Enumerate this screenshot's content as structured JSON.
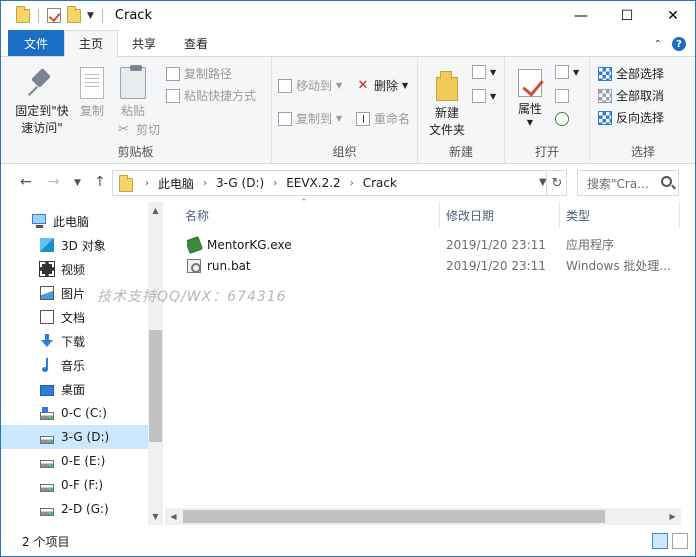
{
  "window": {
    "title": "Crack",
    "minimize": "—",
    "maximize": "☐",
    "close": "✕"
  },
  "tabs": [
    {
      "label": "文件"
    },
    {
      "label": "主页"
    },
    {
      "label": "共享"
    },
    {
      "label": "查看"
    }
  ],
  "ribbon": {
    "clipboard": {
      "label": "剪贴板",
      "pin": "固定到\"快\n速访问\"",
      "copy": "复制",
      "paste": "粘贴",
      "copy_path": "复制路径",
      "paste_shortcut": "粘贴快捷方式",
      "cut": "剪切"
    },
    "organize": {
      "label": "组织",
      "move_to": "移动到",
      "copy_to": "复制到",
      "delete": "删除",
      "rename": "重命名"
    },
    "new": {
      "label": "新建",
      "new_folder": "新建\n文件夹"
    },
    "open": {
      "label": "打开",
      "properties": "属性"
    },
    "select": {
      "label": "选择",
      "select_all": "全部选择",
      "select_none": "全部取消",
      "invert": "反向选择"
    }
  },
  "address": {
    "crumbs": [
      "此电脑",
      "3-G (D:)",
      "EEVX.2.2",
      "Crack"
    ],
    "search_placeholder": "搜索\"Cra..."
  },
  "nav": {
    "items": [
      {
        "label": "此电脑",
        "icon": "computer-icon"
      },
      {
        "label": "3D 对象",
        "icon": "3d-objects-icon"
      },
      {
        "label": "视频",
        "icon": "videos-icon"
      },
      {
        "label": "图片",
        "icon": "pictures-icon"
      },
      {
        "label": "文档",
        "icon": "documents-icon"
      },
      {
        "label": "下载",
        "icon": "downloads-icon"
      },
      {
        "label": "音乐",
        "icon": "music-icon"
      },
      {
        "label": "桌面",
        "icon": "desktop-icon"
      },
      {
        "label": "0-C (C:)",
        "icon": "drive-icon"
      },
      {
        "label": "3-G (D:)",
        "icon": "drive-icon",
        "selected": true
      },
      {
        "label": "0-E (E:)",
        "icon": "drive-icon"
      },
      {
        "label": "0-F (F:)",
        "icon": "drive-icon"
      },
      {
        "label": "2-D (G:)",
        "icon": "drive-icon"
      }
    ]
  },
  "filelist": {
    "columns": [
      "名称",
      "修改日期",
      "类型"
    ],
    "rows": [
      {
        "name": "MentorKG.exe",
        "modified": "2019/1/20 23:11",
        "type": "应用程序",
        "icon": "exe-icon"
      },
      {
        "name": "run.bat",
        "modified": "2019/1/20 23:11",
        "type": "Windows 批处理...",
        "icon": "bat-icon"
      }
    ]
  },
  "watermark": "技术支持QQ/WX：674316",
  "status": {
    "count": "2 个项目"
  },
  "colors": {
    "accent": "#1a6fc4",
    "selection": "#cce8ff"
  }
}
